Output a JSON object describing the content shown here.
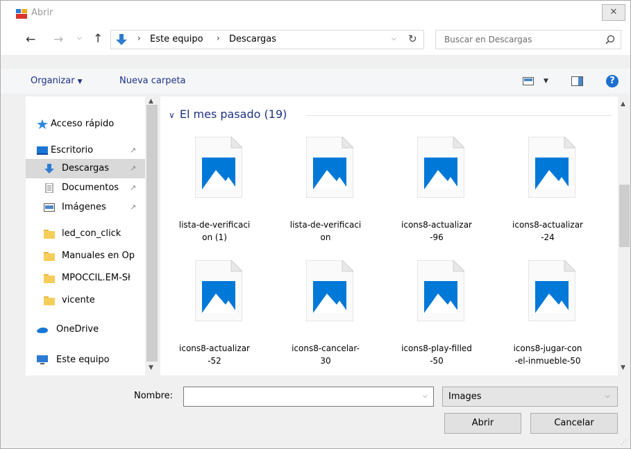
{
  "window": {
    "title": "Abrir",
    "close_glyph": "✕"
  },
  "nav": {
    "back_glyph": "←",
    "forward_glyph": "→",
    "recent_glyph": "⌵",
    "up_glyph": "↑",
    "breadcrumb": [
      "Este equipo",
      "Descargas"
    ],
    "separator": "›",
    "dropdown_glyph": "⌵",
    "refresh_glyph": "↻"
  },
  "search": {
    "placeholder": "Buscar en Descargas"
  },
  "toolbar": {
    "organize_label": "Organizar",
    "organize_caret": "▼",
    "new_folder_label": "Nueva carpeta",
    "view_caret": "▼",
    "help_label": "?"
  },
  "sidebar": {
    "items": [
      {
        "label": "Acceso rápido",
        "icon": "star-icon",
        "pinned": false,
        "selected": false
      },
      {
        "label": "Escritorio",
        "icon": "desktop-icon",
        "pinned": true,
        "selected": false
      },
      {
        "label": "Descargas",
        "icon": "download-icon",
        "pinned": true,
        "selected": true
      },
      {
        "label": "Documentos",
        "icon": "document-icon",
        "pinned": true,
        "selected": false
      },
      {
        "label": "Imágenes",
        "icon": "pictures-icon",
        "pinned": true,
        "selected": false
      },
      {
        "label": "led_con_click",
        "icon": "folder-icon",
        "pinned": false,
        "selected": false
      },
      {
        "label": "Manuales en Op",
        "icon": "folder-icon",
        "pinned": false,
        "selected": false
      },
      {
        "label": "MPOCCIL.EM-Sł",
        "icon": "folder-icon",
        "pinned": false,
        "selected": false
      },
      {
        "label": "vicente",
        "icon": "folder-icon",
        "pinned": false,
        "selected": false
      },
      {
        "label": "OneDrive",
        "icon": "cloud-icon",
        "pinned": false,
        "selected": false
      },
      {
        "label": "Este equipo",
        "icon": "computer-icon",
        "pinned": false,
        "selected": false
      }
    ],
    "pin_glyph": "📌",
    "scroll_up": "▲",
    "scroll_down": "▼"
  },
  "files": {
    "group_chevron": "∨",
    "group_title": "El mes pasado (19)",
    "items": [
      {
        "line1": "lista-de-verificaci",
        "line2": "on (1)"
      },
      {
        "line1": "lista-de-verificaci",
        "line2": "on"
      },
      {
        "line1": "icons8-actualizar",
        "line2": "-96"
      },
      {
        "line1": "icons8-actualizar",
        "line2": "-24"
      },
      {
        "line1": "icons8-actualizar",
        "line2": "-52"
      },
      {
        "line1": "icons8-cancelar-",
        "line2": "30"
      },
      {
        "line1": "icons8-play-filled",
        "line2": "-50"
      },
      {
        "line1": "icons8-jugar-con",
        "line2": "-el-inmueble-50"
      }
    ],
    "scroll_up": "▲",
    "scroll_down": "▼"
  },
  "bottom": {
    "name_label": "Nombre:",
    "name_value": "",
    "name_dropdown": "⌵",
    "filetype_value": "Images",
    "filetype_dropdown": "⌵",
    "open_label": "Abrir",
    "cancel_label": "Cancelar",
    "grip_glyph": "⋰"
  },
  "colors": {
    "accent": "#1e3287",
    "file_icon_blue": "#0078d7",
    "selected_row": "#d9d9d9"
  }
}
